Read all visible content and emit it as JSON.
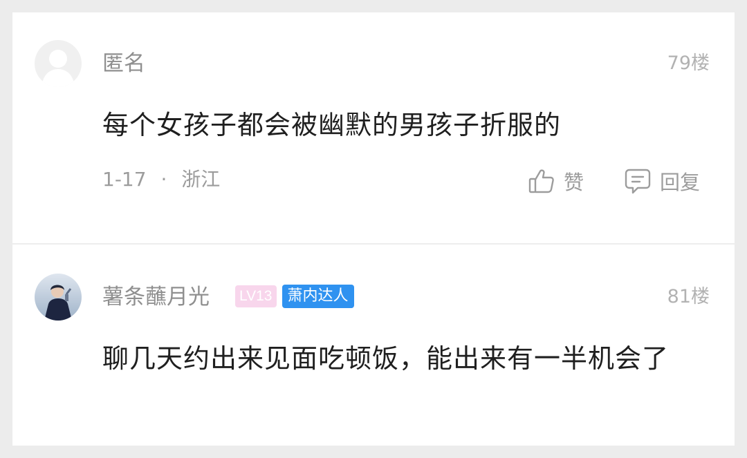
{
  "comments": [
    {
      "username": "匿名",
      "floor": "79楼",
      "content": "每个女孩子都会被幽默的男孩子折服的",
      "date": "1-17",
      "separator": "·",
      "location": "浙江",
      "like_label": "赞",
      "reply_label": "回复",
      "avatar_icon": "anonymous-user-icon"
    },
    {
      "username": "薯条蘸月光",
      "level_badge": "LV13",
      "tag_badge": "萧内达人",
      "floor": "81楼",
      "content": "聊几天约出来见面吃顿饭，能出来有一半机会了",
      "avatar_icon": "user-photo-avatar"
    }
  ],
  "colors": {
    "background": "#ececec",
    "card": "#ffffff",
    "level_badge": "#f8d6ec",
    "tag_badge": "#2f92f0",
    "muted_text": "#9c9c9c",
    "main_text": "#1f1f1f"
  }
}
